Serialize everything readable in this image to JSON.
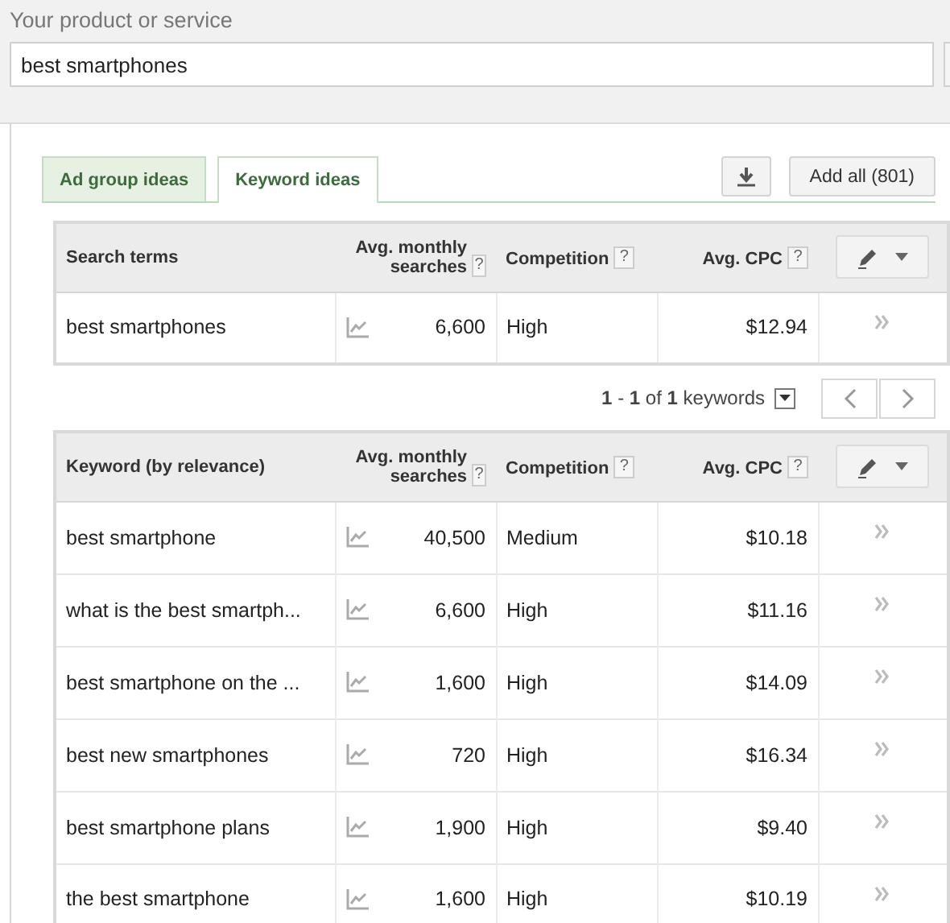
{
  "product_field": {
    "label": "Your product or service",
    "value": "best smartphones"
  },
  "tabs": [
    {
      "label": "Ad group ideas",
      "selected": false
    },
    {
      "label": "Keyword ideas",
      "selected": true
    }
  ],
  "add_all_button": "Add all (801)",
  "search_terms_table": {
    "columns": [
      {
        "label": "Search terms"
      },
      {
        "label": "Avg. monthly searches",
        "help": "?"
      },
      {
        "label": "Competition",
        "help": "?"
      },
      {
        "label": "Avg. CPC",
        "help": "?"
      }
    ],
    "rows": [
      {
        "term": "best smartphones",
        "searches": "6,600",
        "competition": "High",
        "cpc": "$12.94"
      }
    ]
  },
  "pagination": "**1** - **1** of **1** keywords",
  "keyword_table": {
    "columns": [
      {
        "label": "Keyword (by relevance)"
      },
      {
        "label": "Avg. monthly searches",
        "help": "?"
      },
      {
        "label": "Competition",
        "help": "?"
      },
      {
        "label": "Avg. CPC",
        "help": "?"
      }
    ],
    "rows": [
      {
        "term": "best smartphone",
        "searches": "40,500",
        "competition": "Medium",
        "cpc": "$10.18"
      },
      {
        "term": "what is the best smartph...",
        "searches": "6,600",
        "competition": "High",
        "cpc": "$11.16"
      },
      {
        "term": "best smartphone on the ...",
        "searches": "1,600",
        "competition": "High",
        "cpc": "$14.09"
      },
      {
        "term": "best new smartphones",
        "searches": "720",
        "competition": "High",
        "cpc": "$16.34"
      },
      {
        "term": "best smartphone plans",
        "searches": "1,900",
        "competition": "High",
        "cpc": "$9.40"
      },
      {
        "term": "the best smartphone",
        "searches": "1,600",
        "competition": "High",
        "cpc": "$10.19"
      }
    ]
  }
}
